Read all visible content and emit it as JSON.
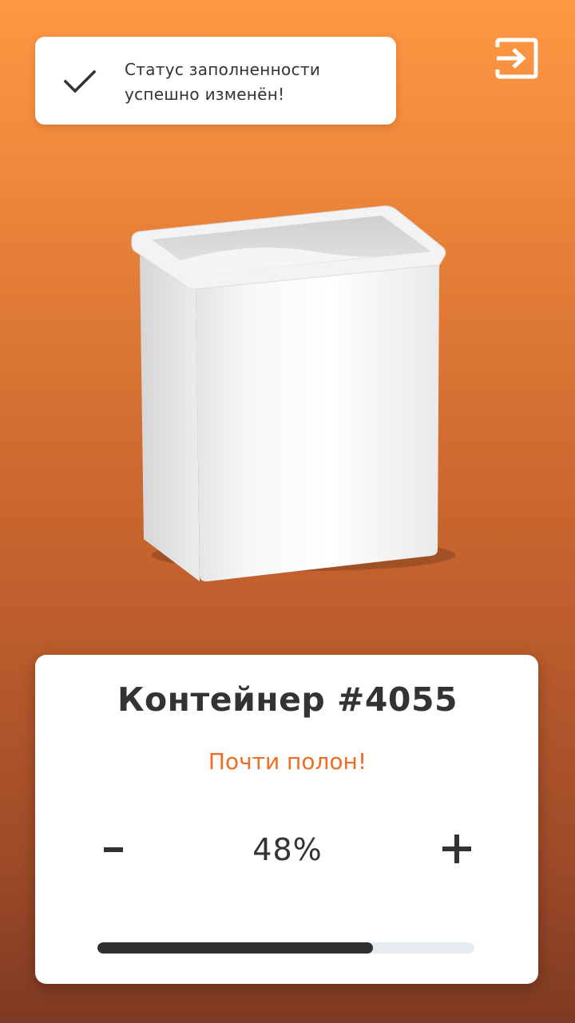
{
  "toast": {
    "line1": "Статус заполненности",
    "line2": "успешно изменён!",
    "icon": "check-icon"
  },
  "header": {
    "logout_icon": "logout-icon"
  },
  "container": {
    "title": "Контейнер #4055",
    "status": "Почти полон!",
    "status_color": "#f26b22",
    "decrease_label": "–",
    "increase_label": "+",
    "fill_percent_label": "48%",
    "progress_bar_fill_fraction": 0.73
  },
  "colors": {
    "background_top": "#ff9843",
    "background_bottom": "#7e3a22",
    "text_dark": "#333333",
    "progress_fill": "#2f2f2f",
    "progress_track": "#e6ebef"
  }
}
